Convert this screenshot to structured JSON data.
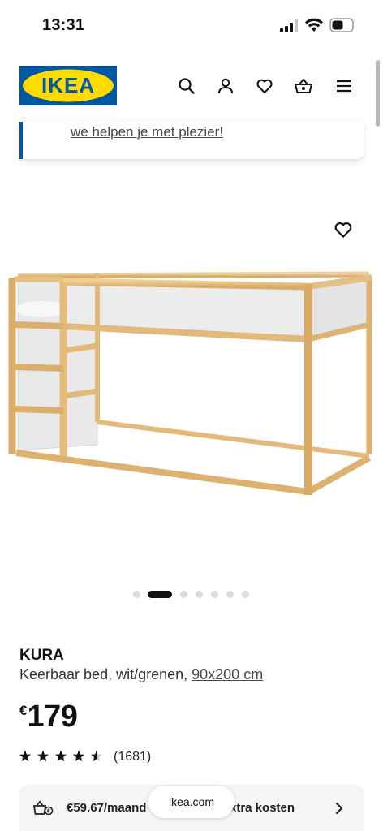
{
  "status_bar": {
    "time": "13:31",
    "icons": [
      "signal-icon",
      "wifi-icon",
      "battery-icon"
    ]
  },
  "header": {
    "logo_text": "IKEA",
    "icons": [
      "search-icon",
      "profile-icon",
      "heart-icon",
      "basket-icon",
      "menu-icon"
    ],
    "brand_colors": {
      "blue": "#0058a3",
      "yellow": "#ffdb00"
    }
  },
  "notice": {
    "link_text": "we helpen je met plezier!"
  },
  "carousel": {
    "total": 7,
    "active_index": 1
  },
  "product": {
    "name": "KURA",
    "description": "Keerbaar bed, wit/grenen, ",
    "size": "90x200 cm",
    "price_currency": "€",
    "price": "179",
    "rating": 4.5,
    "review_count": "(1681)"
  },
  "finance": {
    "monthly_text": "€59.67/maand",
    "extra_text": "xtra kosten"
  },
  "browser": {
    "url": "ikea.com"
  }
}
